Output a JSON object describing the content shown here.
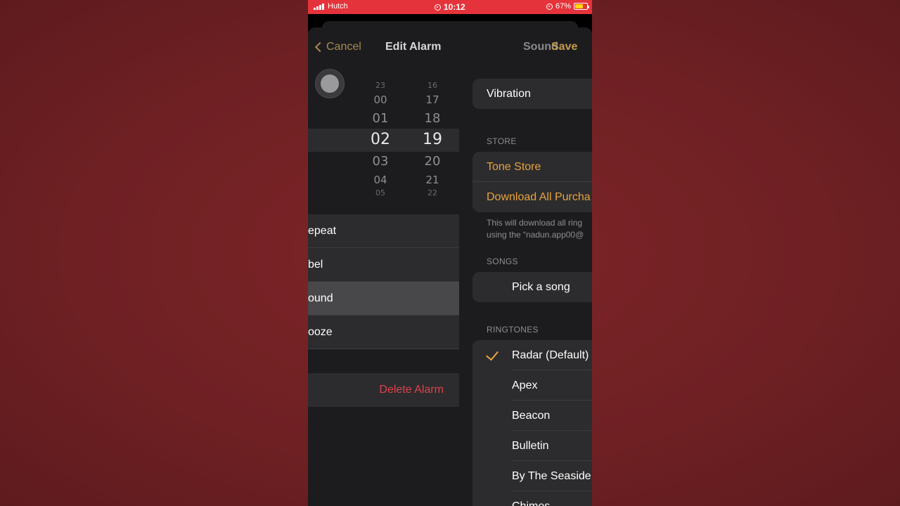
{
  "status_bar": {
    "carrier": "Hutch",
    "time": "10:12",
    "battery": "67%",
    "battery_level": 0.67,
    "color": "#e5333b"
  },
  "nav": {
    "cancel_label": "Cancel",
    "title": "Edit Alarm",
    "sound_label": "Sound",
    "save_label": "Save"
  },
  "picker": {
    "hours": [
      "23",
      "00",
      "01",
      "02",
      "03",
      "04",
      "05"
    ],
    "minutes": [
      "16",
      "17",
      "18",
      "19",
      "20",
      "21",
      "22"
    ],
    "selected_hour": "02",
    "selected_minute": "19"
  },
  "alarm_options": [
    {
      "label": "epeat"
    },
    {
      "label": "bel"
    },
    {
      "label": "ound"
    },
    {
      "label": "ooze"
    }
  ],
  "delete_label": "Delete Alarm",
  "sound_panel": {
    "vibration_label": "Vibration",
    "store_header": "STORE",
    "tone_store": "Tone Store",
    "download_all": "Download All Purcha",
    "store_note_line1": "This will download all ring",
    "store_note_line2": "using the “nadun.app00@",
    "songs_header": "SONGS",
    "pick_song": "Pick a song",
    "ringtones_header": "RINGTONES",
    "ringtones": [
      "Radar (Default)",
      "Apex",
      "Beacon",
      "Bulletin",
      "By The Seaside",
      "Chimes"
    ],
    "selected_ringtone": "Radar (Default)"
  },
  "colors": {
    "accent": "#e8a33d",
    "destructive": "#e0424b",
    "background": "#6e2023"
  }
}
